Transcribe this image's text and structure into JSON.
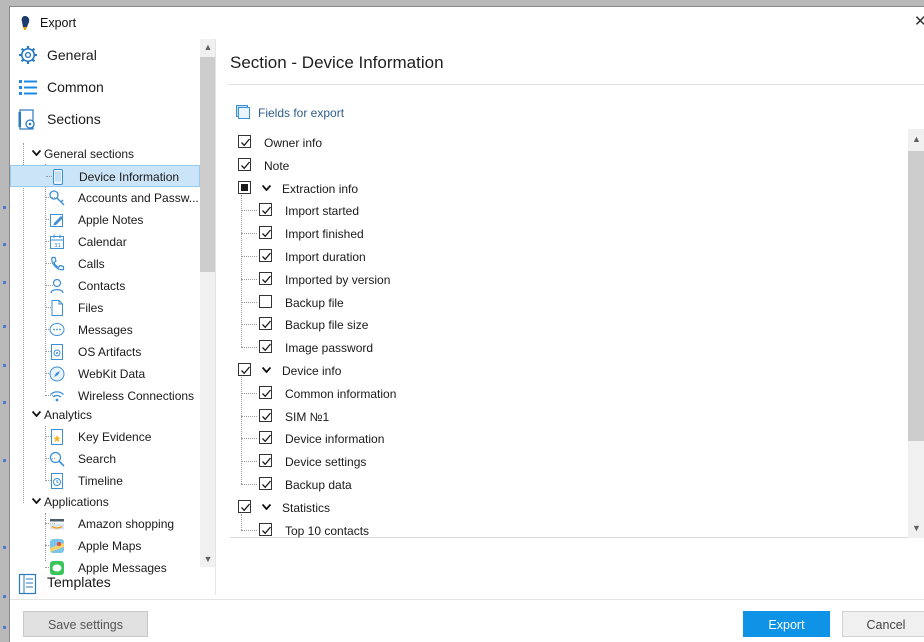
{
  "window": {
    "title": "Export"
  },
  "nav": {
    "top_items": [
      {
        "label": "General",
        "icon": "gear-icon"
      },
      {
        "label": "Common",
        "icon": "list-icon"
      },
      {
        "label": "Sections",
        "icon": "sections-icon"
      }
    ],
    "tree": [
      {
        "group": "General sections",
        "items": [
          {
            "label": "Device Information",
            "icon": "phone-icon",
            "selected": true
          },
          {
            "label": "Accounts and Passw...",
            "icon": "key-icon"
          },
          {
            "label": "Apple Notes",
            "icon": "note-icon"
          },
          {
            "label": "Calendar",
            "icon": "calendar-icon"
          },
          {
            "label": "Calls",
            "icon": "phone-call-icon"
          },
          {
            "label": "Contacts",
            "icon": "contact-icon"
          },
          {
            "label": "Files",
            "icon": "file-icon"
          },
          {
            "label": "Messages",
            "icon": "message-icon"
          },
          {
            "label": "OS Artifacts",
            "icon": "os-artifact-icon"
          },
          {
            "label": "WebKit Data",
            "icon": "webkit-icon"
          },
          {
            "label": "Wireless Connections",
            "icon": "wifi-icon"
          }
        ]
      },
      {
        "group": "Analytics",
        "items": [
          {
            "label": "Key Evidence",
            "icon": "star-doc-icon"
          },
          {
            "label": "Search",
            "icon": "search-icon"
          },
          {
            "label": "Timeline",
            "icon": "timeline-icon"
          }
        ]
      },
      {
        "group": "Applications",
        "items": [
          {
            "label": "Amazon shopping",
            "icon": "amazon-icon"
          },
          {
            "label": "Apple Maps",
            "icon": "maps-icon"
          },
          {
            "label": "Apple Messages",
            "icon": "apple-messages-icon"
          }
        ]
      }
    ],
    "templates_label": "Templates"
  },
  "main": {
    "section_title": "Section - Device Information",
    "fields_header": "Fields for export",
    "fields": [
      {
        "label": "Owner info",
        "state": "checked",
        "level": 0
      },
      {
        "label": "Note",
        "state": "checked",
        "level": 0
      },
      {
        "label": "Extraction info",
        "state": "partial",
        "level": 0,
        "expandable": true
      },
      {
        "label": "Import started",
        "state": "checked",
        "level": 1
      },
      {
        "label": "Import finished",
        "state": "checked",
        "level": 1
      },
      {
        "label": "Import duration",
        "state": "checked",
        "level": 1
      },
      {
        "label": "Imported by version",
        "state": "checked",
        "level": 1
      },
      {
        "label": "Backup file",
        "state": "unchecked",
        "level": 1
      },
      {
        "label": "Backup file size",
        "state": "checked",
        "level": 1
      },
      {
        "label": "Image password",
        "state": "checked",
        "level": 1
      },
      {
        "label": "Device info",
        "state": "checked",
        "level": 0,
        "expandable": true
      },
      {
        "label": "Common information",
        "state": "checked",
        "level": 1
      },
      {
        "label": "SIM №1",
        "state": "checked",
        "level": 1
      },
      {
        "label": "Device information",
        "state": "checked",
        "level": 1
      },
      {
        "label": "Device settings",
        "state": "checked",
        "level": 1
      },
      {
        "label": "Backup data",
        "state": "checked",
        "level": 1
      },
      {
        "label": "Statistics",
        "state": "checked",
        "level": 0,
        "expandable": true
      },
      {
        "label": "Top 10 contacts",
        "state": "checked",
        "level": 1
      }
    ]
  },
  "footer": {
    "save_label": "Save settings",
    "export_label": "Export",
    "cancel_label": "Cancel"
  },
  "colors": {
    "accent": "#0f93e6",
    "selection": "#cce4f7",
    "link": "#2f5d8a"
  }
}
